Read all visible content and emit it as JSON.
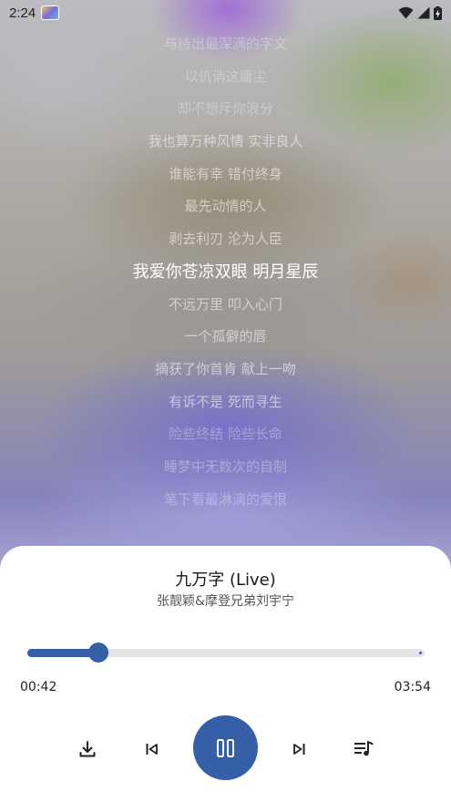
{
  "status_bar": {
    "time": "2:24"
  },
  "lyrics": [
    {
      "text": "与待出最深满的字文",
      "state": "faded"
    },
    {
      "text": "以讥诮这庸尘",
      "state": "faded"
    },
    {
      "text": "却不想斥你浪分",
      "state": "faded"
    },
    {
      "text": "我也算万种风情 实非良人",
      "state": "normal"
    },
    {
      "text": "谁能有幸 错付终身",
      "state": "normal"
    },
    {
      "text": "最先动情的人",
      "state": "normal"
    },
    {
      "text": "剥去利刃 沦为人臣",
      "state": "normal"
    },
    {
      "text": "我爱你苍凉双眼 明月星辰",
      "state": "active"
    },
    {
      "text": "不远万里 叩入心门",
      "state": "normal"
    },
    {
      "text": "一个孤僻的唇",
      "state": "normal"
    },
    {
      "text": "摘获了你首肯 献上一吻",
      "state": "normal"
    },
    {
      "text": "有诉不是 死而寻生",
      "state": "normal"
    },
    {
      "text": "险些终结 险些长命",
      "state": "faded"
    },
    {
      "text": "睡梦中无数次的自制",
      "state": "faded"
    },
    {
      "text": "笔下看最淋漓的爱恨",
      "state": "faded"
    }
  ],
  "player": {
    "title": "九万字 (Live)",
    "artist": "张靓颖&摩登兄弟刘宇宁",
    "current_time": "00:42",
    "total_time": "03:54",
    "progress": 0.18,
    "accent_color": "#3560a8"
  },
  "controls": {
    "download_icon": "download-icon",
    "previous_icon": "skip-previous-icon",
    "play_pause_icon": "pause-icon",
    "next_icon": "skip-next-icon",
    "playlist_icon": "playlist-icon"
  }
}
